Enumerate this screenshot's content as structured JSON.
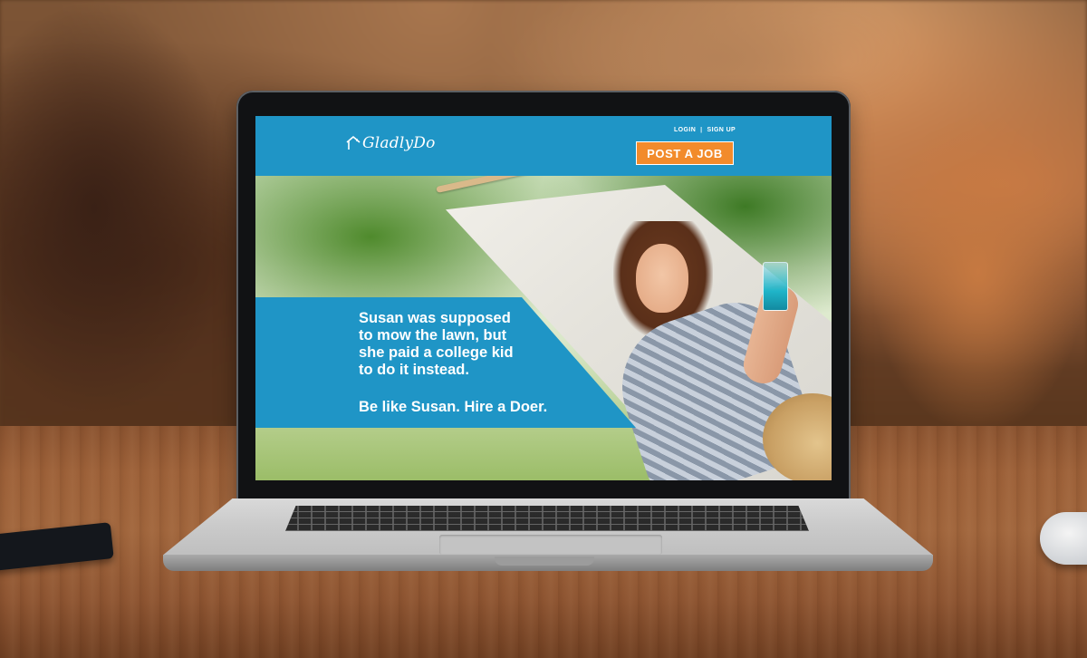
{
  "site": {
    "logo_text": "GladlyDo",
    "colors": {
      "brand_blue": "#1f95c6",
      "cta_orange": "#f28b2b"
    }
  },
  "header": {
    "login_label": "LOGIN",
    "separator": "|",
    "signup_label": "SIGN UP",
    "post_job_label": "POST A JOB"
  },
  "hero": {
    "tagline_lines": [
      "Susan was supposed",
      "to mow the lawn, but",
      "she paid a college kid",
      "to do it instead."
    ],
    "cta": "Be like Susan. Hire a Doer."
  },
  "icons": {
    "logo_mark": "house-icon"
  }
}
